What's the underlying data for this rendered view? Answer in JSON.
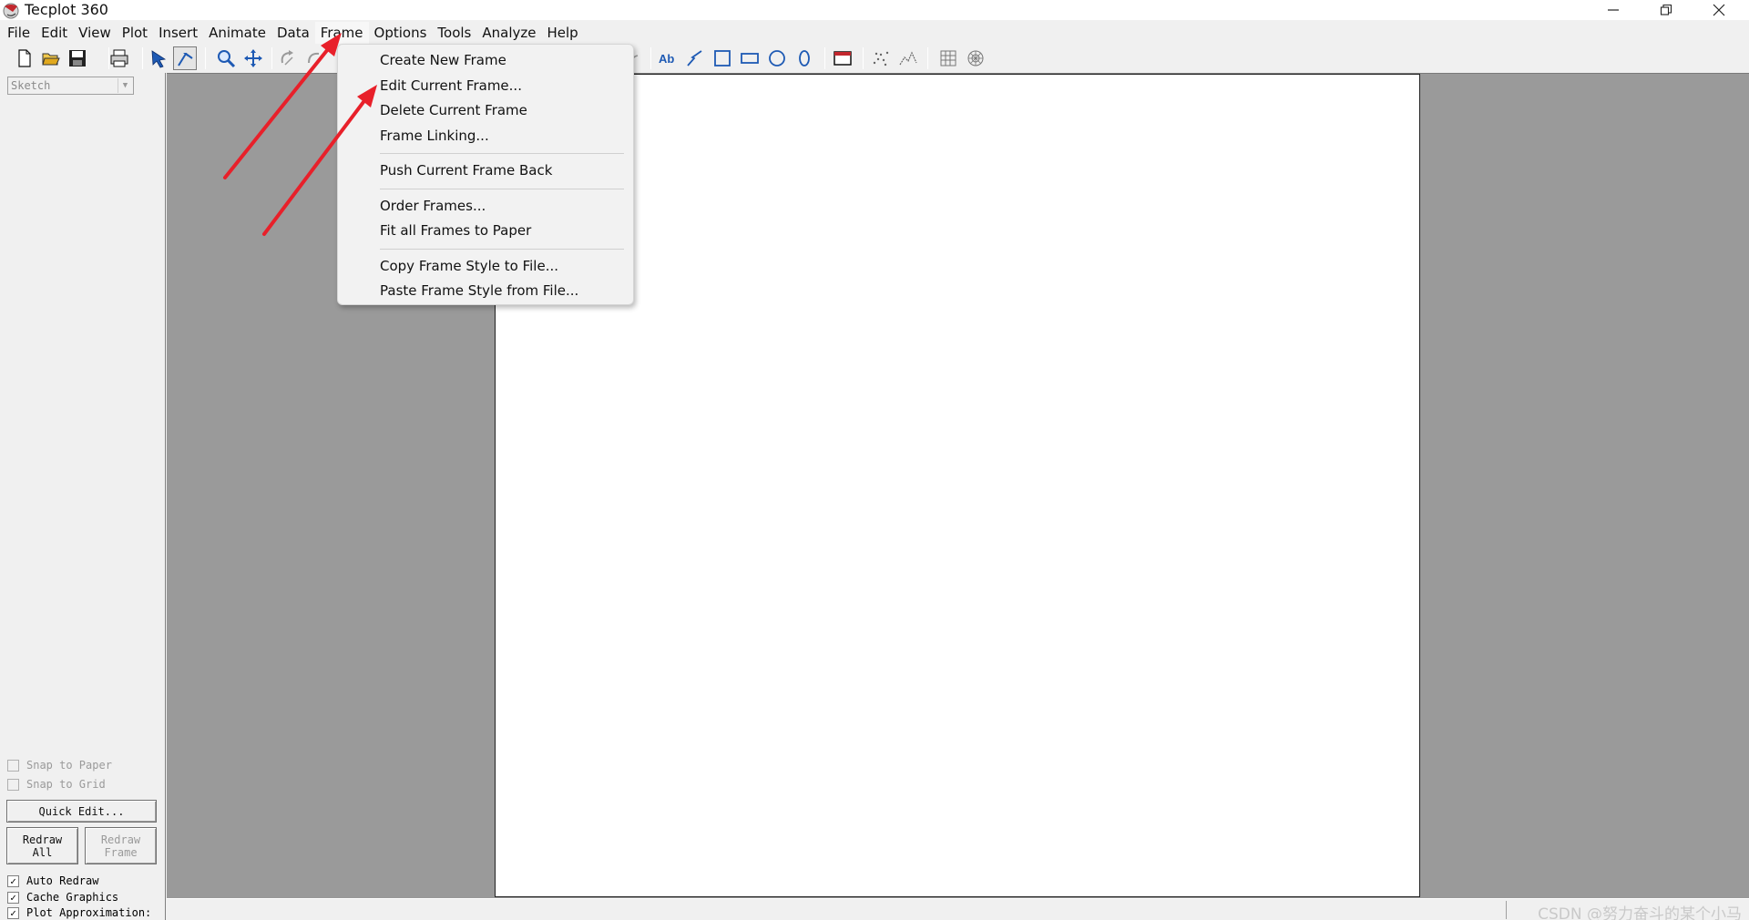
{
  "window": {
    "title": "Tecplot 360",
    "controls": [
      "minimize-icon",
      "restore-icon",
      "close-icon"
    ]
  },
  "menubar": {
    "items": [
      {
        "label": "File"
      },
      {
        "label": "Edit"
      },
      {
        "label": "View"
      },
      {
        "label": "Plot"
      },
      {
        "label": "Insert"
      },
      {
        "label": "Animate"
      },
      {
        "label": "Data"
      },
      {
        "label": "Frame"
      },
      {
        "label": "Options"
      },
      {
        "label": "Tools"
      },
      {
        "label": "Analyze"
      },
      {
        "label": "Help"
      }
    ],
    "active": "Frame"
  },
  "frame_menu": {
    "items": [
      {
        "label": "Create New Frame"
      },
      {
        "label": "Edit Current Frame..."
      },
      {
        "label": "Delete Current Frame"
      },
      {
        "label": "Frame Linking..."
      },
      {
        "label": "Push Current Frame Back"
      },
      {
        "label": "Order Frames..."
      },
      {
        "label": "Fit all Frames to Paper"
      },
      {
        "label": "Copy Frame Style to File..."
      },
      {
        "label": "Paste Frame Style from File..."
      }
    ]
  },
  "toolbar": {
    "icons": [
      "new-file-icon",
      "open-folder-icon",
      "save-icon",
      "print-icon",
      "select-arrow-icon",
      "adjustor-icon",
      "zoom-icon",
      "translate-icon",
      "rotate-icon",
      "rotate-alt-icon",
      "probe-icon",
      "text-ab-icon",
      "polyline-icon",
      "square-icon",
      "rectangle-icon",
      "circle-icon",
      "ellipse-icon",
      "frame-icon",
      "scatter-icon",
      "line-plot-icon",
      "grid-icon",
      "polar-icon"
    ]
  },
  "sidebar": {
    "mode": "Sketch",
    "snap_to_paper": "Snap to Paper",
    "snap_to_grid": "Snap to Grid",
    "quick_edit": "Quick Edit...",
    "redraw_all_line1": "Redraw",
    "redraw_all_line2": "All",
    "redraw_frame_line1": "Redraw",
    "redraw_frame_line2": "Frame",
    "auto_redraw": "Auto Redraw",
    "cache_graphics": "Cache Graphics",
    "plot_approximation": "Plot Approximation:",
    "checkmark": "✓"
  },
  "statusbar": {
    "watermark": "CSDN @努力奋斗的某个小马"
  },
  "colors": {
    "annotation_arrow": "#e8202a",
    "workspace": "#9a9a9a",
    "paper": "#ffffff"
  }
}
